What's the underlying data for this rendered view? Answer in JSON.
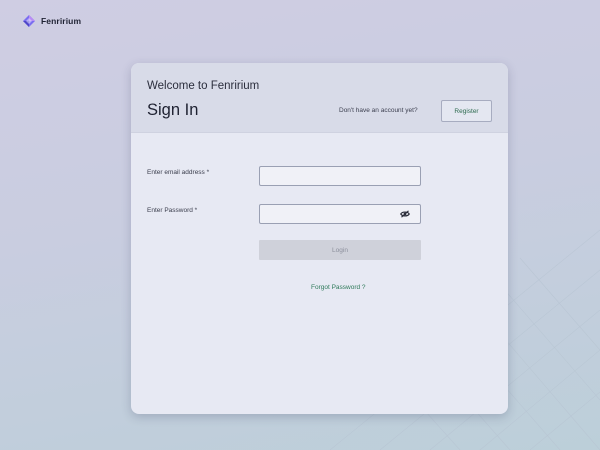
{
  "brand": {
    "name": "Fenririum",
    "logo_icon": "diamond-logo-icon",
    "logo_colors": [
      "#7b6ef0",
      "#b98cf5",
      "#4f46c9"
    ]
  },
  "card": {
    "welcome_text": "Welcome to Fenririum",
    "title": "Sign In",
    "no_account_text": "Don't have an account yet?",
    "register_label": "Register"
  },
  "form": {
    "email_label": "Enter email address *",
    "email_value": "",
    "password_label": "Enter Password *",
    "password_value": "",
    "password_toggle_icon": "eye-slash-icon",
    "login_label": "Login",
    "login_disabled": true,
    "forgot_label": "Forgot Password ?"
  },
  "colors": {
    "background": "#cfcde3",
    "card": "#e7e9f3",
    "card_header": "#d8dbe8",
    "link": "#2f7a5a",
    "button_disabled": "#cfd1da"
  }
}
